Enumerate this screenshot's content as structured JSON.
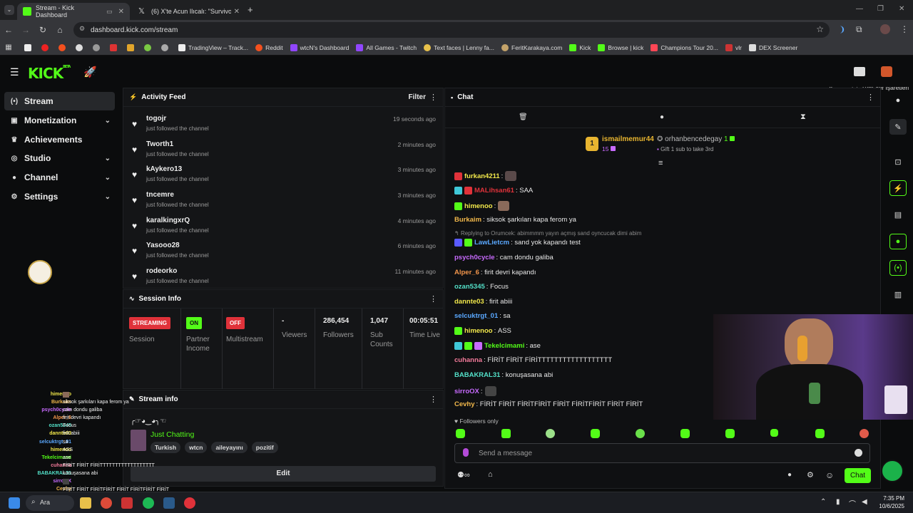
{
  "browser": {
    "tabs": [
      {
        "title": "Stream - Kick Dashboard",
        "active": true
      },
      {
        "title": "(6) X'te Acun Ilıcalı: \"Survivor 2C",
        "active": false
      }
    ],
    "url": "dashboard.kick.com/stream",
    "bookmarks": [
      "TradingView – Track...",
      "Reddit",
      "wtcN's Dashboard",
      "All Games - Twitch",
      "Text faces | Lenny fa...",
      "FeritKarakaya.com",
      "Kick",
      "Browse | kick",
      "Champions Tour 20...",
      "vlr",
      "DEX Screener"
    ],
    "all_bookmarks": "Tüm Yer İşaretleri"
  },
  "app": {
    "logo": "KICK",
    "logo_tag": "BETA"
  },
  "sidebar": {
    "items": [
      {
        "label": "Stream",
        "active": true
      },
      {
        "label": "Monetization"
      },
      {
        "label": "Achievements"
      },
      {
        "label": "Studio"
      },
      {
        "label": "Channel"
      },
      {
        "label": "Settings"
      }
    ]
  },
  "activity": {
    "title": "Activity Feed",
    "filter": "Filter",
    "items": [
      {
        "user": "togojr",
        "desc": "just followed the channel",
        "time": "19 seconds ago"
      },
      {
        "user": "Tworth1",
        "desc": "just followed the channel",
        "time": "2 minutes ago"
      },
      {
        "user": "kAykero13",
        "desc": "just followed the channel",
        "time": "3 minutes ago"
      },
      {
        "user": "tncemre",
        "desc": "just followed the channel",
        "time": "3 minutes ago"
      },
      {
        "user": "karalkingxrQ",
        "desc": "just followed the channel",
        "time": "4 minutes ago"
      },
      {
        "user": "Yasooo28",
        "desc": "just followed the channel",
        "time": "6 minutes ago"
      },
      {
        "user": "rodeorko",
        "desc": "just followed the channel",
        "time": "11 minutes ago"
      }
    ]
  },
  "session": {
    "title": "Session Info",
    "streaming": "STREAMING",
    "session_label": "Session",
    "on": "ON",
    "partner_label": "Partner Income",
    "off": "OFF",
    "multistream_label": "Multistream",
    "viewers_value": "-",
    "viewers_label": "Viewers",
    "followers_value": "286,454",
    "followers_label": "Followers",
    "subs_value": "1,047",
    "subs_label": "Sub Counts",
    "time_value": "00:05:51",
    "time_label": "Time Live"
  },
  "streaminfo": {
    "title": "Stream info",
    "stream_title": "╭☞◕‿◕╮☜",
    "category": "Just Chatting",
    "tags": [
      "Turkish",
      "wtcn",
      "aileyayını",
      "pozitif"
    ],
    "edit": "Edit"
  },
  "chat": {
    "title": "Chat",
    "top_gifter_name": "ismailmemur44",
    "top_gifter_count": "15",
    "top_rank": "1",
    "second_name": "orhanbencedegay",
    "second_count": "1",
    "second_note": "Gift 1 sub to take 3rd",
    "reply_note": "Replying to Orumcek: abimmmm yayın açmış sand oyncucak dimi abim",
    "messages": [
      {
        "name": "furkan4211",
        "color": "#f2e84b",
        "text": ""
      },
      {
        "name": "MALihsan61",
        "color": "#e0323a",
        "text": "SAA"
      },
      {
        "name": "himenoo",
        "color": "#f2e84b",
        "text": ""
      },
      {
        "name": "Burkaim",
        "color": "#f2b84b",
        "text": "siksok şarkıları kapa ferom ya"
      },
      {
        "name": "LawLietcm",
        "color": "#5aa8ff",
        "text": "sand yok kapandı test"
      },
      {
        "name": "psych0cycle",
        "color": "#c86bff",
        "text": "cam dondu galiba"
      },
      {
        "name": "Alper_6",
        "color": "#f2954b",
        "text": "firit devri kapandı"
      },
      {
        "name": "ozan5345",
        "color": "#53e0c8",
        "text": "Focus"
      },
      {
        "name": "dannte03",
        "color": "#f2e84b",
        "text": "firit abiii"
      },
      {
        "name": "selcuktrgt_01",
        "color": "#5aa8ff",
        "text": "sa"
      },
      {
        "name": "himenoo",
        "color": "#f2e84b",
        "text": "ASS"
      },
      {
        "name": "Tekelcimami",
        "color": "#53fc18",
        "text": "ase"
      },
      {
        "name": "cuhanna",
        "color": "#f27a9a",
        "text": "FİRİT FİRİT FİRİTTTTTTTTTTTTTTTTTT"
      },
      {
        "name": "BABAKRAL31",
        "color": "#53e0c8",
        "text": "konuşasana abi"
      },
      {
        "name": "sirroOX",
        "color": "#c86bff",
        "text": ""
      },
      {
        "name": "Cevhy",
        "color": "#f2b84b",
        "text": "FİRİT FİRİT FİRİTFİRİT FİRİT FİRİTFİRİT FİRİT FİRİT"
      }
    ],
    "followers_only": "Followers only",
    "placeholder": "Send a message",
    "send": "Chat"
  },
  "overlay": [
    {
      "name": "himenoo",
      "color": "#f2e84b",
      "text": ""
    },
    {
      "name": "Burkaim",
      "color": "#f2b84b",
      "text": "siksok şarkıları kapa ferom ya"
    },
    {
      "name": "psych0cycle",
      "color": "#c86bff",
      "text": "cam dondu galiba"
    },
    {
      "name": "Alper_6",
      "color": "#f2954b",
      "text": "firit devri kapandı"
    },
    {
      "name": "ozan5345",
      "color": "#53e0c8",
      "text": "Focus"
    },
    {
      "name": "dannte03",
      "color": "#f2e84b",
      "text": "firit abiii"
    },
    {
      "name": "selcuktrgt_01",
      "color": "#5aa8ff",
      "text": "sa"
    },
    {
      "name": "himenoo",
      "color": "#f2e84b",
      "text": "ASS"
    },
    {
      "name": "Tekelcimami",
      "color": "#53fc18",
      "text": "ase"
    },
    {
      "name": "cuhanna",
      "color": "#f27a9a",
      "text": "FİRİT FİRİT FİRİTTTTTTTTTTTTTTTTTT"
    },
    {
      "name": "BABAKRAL31",
      "color": "#53e0c8",
      "text": "konuşasana abi"
    },
    {
      "name": "sirroOX",
      "color": "#c86bff",
      "text": ""
    },
    {
      "name": "Cevhy",
      "color": "#f2b84b",
      "text": "FİRİT FİRİT FİRİTFİRİT FİRİT FİRİTFİRİT FİRİT FİRİT"
    }
  ],
  "taskbar": {
    "search": "Ara",
    "time": "7:35 PM",
    "date": "10/6/2025"
  }
}
